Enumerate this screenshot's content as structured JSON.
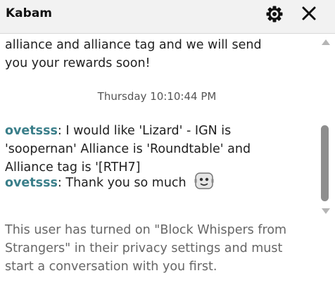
{
  "header": {
    "title": "Kabam",
    "settings_icon": "gear-icon",
    "close_icon": "close-icon"
  },
  "messages": {
    "top_text_line1": "alliance and alliance tag and we will send",
    "top_text_line2": "you your rewards soon!",
    "timestamp": "Thursday 10:10:44 PM",
    "msg1": {
      "sender": "ovetsss",
      "sep": ":",
      "line1": " I would like 'Lizard' - IGN is",
      "line2": "'soopernan' Alliance is 'Roundtable' and",
      "line3": "Alliance tag is '[RTH7]"
    },
    "msg2": {
      "sender": "ovetsss",
      "sep": ":",
      "text": " Thank you so much",
      "emoji_icon": "robot-face-emoji-icon"
    },
    "notice_line1": "This user has turned on \"Block Whispers from",
    "notice_line2": "Strangers\" in their privacy settings and must",
    "notice_line3": "start a conversation with you first."
  },
  "colors": {
    "header_bg": "#f2f2f2",
    "sender_name": "#3b7f8a",
    "notice_text": "#666666",
    "scroll_thumb": "#8e8e8e"
  }
}
